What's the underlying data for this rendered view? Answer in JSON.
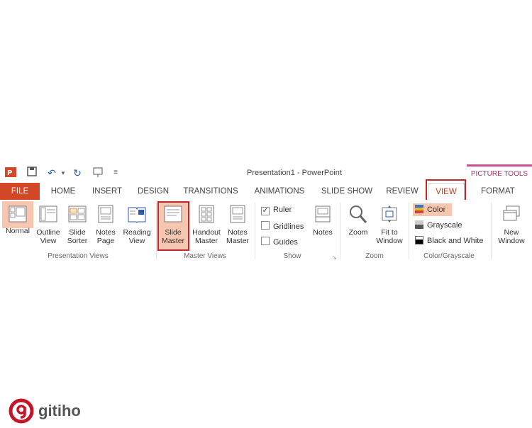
{
  "window": {
    "title": "Presentation1 - PowerPoint",
    "context_tab_group": "PICTURE TOOLS"
  },
  "quick_access": [
    "app-icon",
    "save-icon",
    "undo-icon",
    "redo-icon",
    "present-icon",
    "customize-icon"
  ],
  "tabs": [
    "FILE",
    "HOME",
    "INSERT",
    "DESIGN",
    "TRANSITIONS",
    "ANIMATIONS",
    "SLIDE SHOW",
    "REVIEW",
    "VIEW",
    "FORMAT"
  ],
  "groups": {
    "presentation_views": {
      "label": "Presentation Views",
      "buttons": [
        "Normal",
        "Outline\nView",
        "Slide\nSorter",
        "Notes\nPage",
        "Reading\nView"
      ]
    },
    "master_views": {
      "label": "Master Views",
      "buttons": [
        "Slide\nMaster",
        "Handout\nMaster",
        "Notes\nMaster"
      ]
    },
    "show": {
      "label": "Show",
      "checks": [
        {
          "label": "Ruler",
          "checked": true
        },
        {
          "label": "Gridlines",
          "checked": false
        },
        {
          "label": "Guides",
          "checked": false
        }
      ],
      "notes": "Notes"
    },
    "zoom": {
      "label": "Zoom",
      "buttons": [
        "Zoom",
        "Fit to\nWindow"
      ]
    },
    "color_grayscale": {
      "label": "Color/Grayscale",
      "options": [
        "Color",
        "Grayscale",
        "Black and White"
      ]
    },
    "window": {
      "buttons": [
        "New\nWindow"
      ]
    }
  },
  "brand": {
    "name": "gitiho",
    "accent": "#c43e1c",
    "file_tab": "#d24726",
    "highlight": "#c0282d"
  }
}
